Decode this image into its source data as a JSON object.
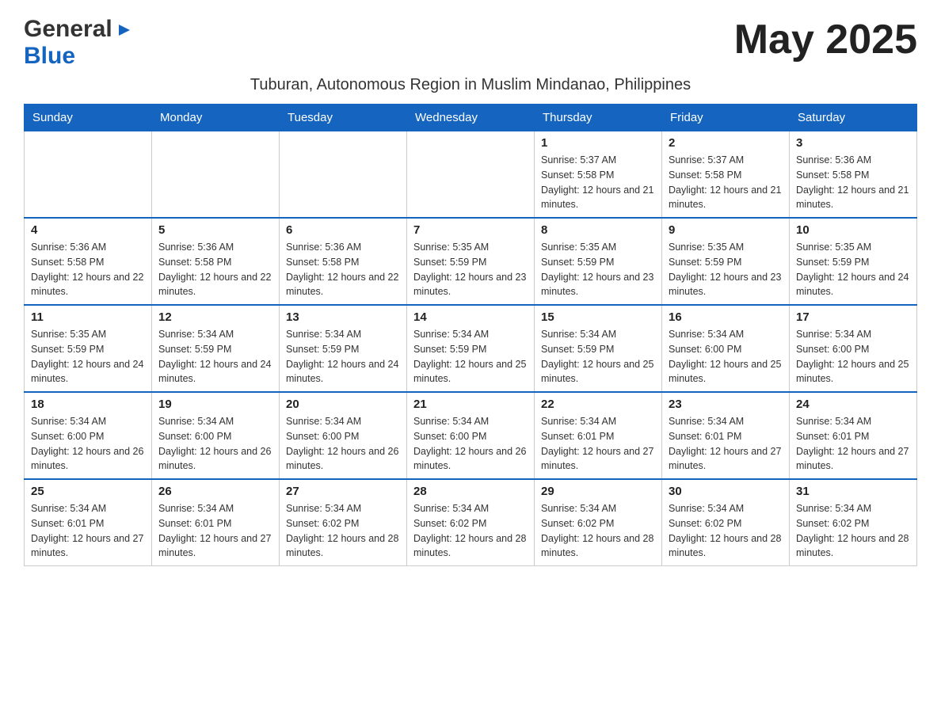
{
  "logo": {
    "general": "General",
    "blue": "Blue",
    "arrow": "▶"
  },
  "title": "May 2025",
  "subtitle": "Tuburan, Autonomous Region in Muslim Mindanao, Philippines",
  "weekdays": [
    "Sunday",
    "Monday",
    "Tuesday",
    "Wednesday",
    "Thursday",
    "Friday",
    "Saturday"
  ],
  "weeks": [
    [
      {
        "day": "",
        "sunrise": "",
        "sunset": "",
        "daylight": ""
      },
      {
        "day": "",
        "sunrise": "",
        "sunset": "",
        "daylight": ""
      },
      {
        "day": "",
        "sunrise": "",
        "sunset": "",
        "daylight": ""
      },
      {
        "day": "",
        "sunrise": "",
        "sunset": "",
        "daylight": ""
      },
      {
        "day": "1",
        "sunrise": "Sunrise: 5:37 AM",
        "sunset": "Sunset: 5:58 PM",
        "daylight": "Daylight: 12 hours and 21 minutes."
      },
      {
        "day": "2",
        "sunrise": "Sunrise: 5:37 AM",
        "sunset": "Sunset: 5:58 PM",
        "daylight": "Daylight: 12 hours and 21 minutes."
      },
      {
        "day": "3",
        "sunrise": "Sunrise: 5:36 AM",
        "sunset": "Sunset: 5:58 PM",
        "daylight": "Daylight: 12 hours and 21 minutes."
      }
    ],
    [
      {
        "day": "4",
        "sunrise": "Sunrise: 5:36 AM",
        "sunset": "Sunset: 5:58 PM",
        "daylight": "Daylight: 12 hours and 22 minutes."
      },
      {
        "day": "5",
        "sunrise": "Sunrise: 5:36 AM",
        "sunset": "Sunset: 5:58 PM",
        "daylight": "Daylight: 12 hours and 22 minutes."
      },
      {
        "day": "6",
        "sunrise": "Sunrise: 5:36 AM",
        "sunset": "Sunset: 5:58 PM",
        "daylight": "Daylight: 12 hours and 22 minutes."
      },
      {
        "day": "7",
        "sunrise": "Sunrise: 5:35 AM",
        "sunset": "Sunset: 5:59 PM",
        "daylight": "Daylight: 12 hours and 23 minutes."
      },
      {
        "day": "8",
        "sunrise": "Sunrise: 5:35 AM",
        "sunset": "Sunset: 5:59 PM",
        "daylight": "Daylight: 12 hours and 23 minutes."
      },
      {
        "day": "9",
        "sunrise": "Sunrise: 5:35 AM",
        "sunset": "Sunset: 5:59 PM",
        "daylight": "Daylight: 12 hours and 23 minutes."
      },
      {
        "day": "10",
        "sunrise": "Sunrise: 5:35 AM",
        "sunset": "Sunset: 5:59 PM",
        "daylight": "Daylight: 12 hours and 24 minutes."
      }
    ],
    [
      {
        "day": "11",
        "sunrise": "Sunrise: 5:35 AM",
        "sunset": "Sunset: 5:59 PM",
        "daylight": "Daylight: 12 hours and 24 minutes."
      },
      {
        "day": "12",
        "sunrise": "Sunrise: 5:34 AM",
        "sunset": "Sunset: 5:59 PM",
        "daylight": "Daylight: 12 hours and 24 minutes."
      },
      {
        "day": "13",
        "sunrise": "Sunrise: 5:34 AM",
        "sunset": "Sunset: 5:59 PM",
        "daylight": "Daylight: 12 hours and 24 minutes."
      },
      {
        "day": "14",
        "sunrise": "Sunrise: 5:34 AM",
        "sunset": "Sunset: 5:59 PM",
        "daylight": "Daylight: 12 hours and 25 minutes."
      },
      {
        "day": "15",
        "sunrise": "Sunrise: 5:34 AM",
        "sunset": "Sunset: 5:59 PM",
        "daylight": "Daylight: 12 hours and 25 minutes."
      },
      {
        "day": "16",
        "sunrise": "Sunrise: 5:34 AM",
        "sunset": "Sunset: 6:00 PM",
        "daylight": "Daylight: 12 hours and 25 minutes."
      },
      {
        "day": "17",
        "sunrise": "Sunrise: 5:34 AM",
        "sunset": "Sunset: 6:00 PM",
        "daylight": "Daylight: 12 hours and 25 minutes."
      }
    ],
    [
      {
        "day": "18",
        "sunrise": "Sunrise: 5:34 AM",
        "sunset": "Sunset: 6:00 PM",
        "daylight": "Daylight: 12 hours and 26 minutes."
      },
      {
        "day": "19",
        "sunrise": "Sunrise: 5:34 AM",
        "sunset": "Sunset: 6:00 PM",
        "daylight": "Daylight: 12 hours and 26 minutes."
      },
      {
        "day": "20",
        "sunrise": "Sunrise: 5:34 AM",
        "sunset": "Sunset: 6:00 PM",
        "daylight": "Daylight: 12 hours and 26 minutes."
      },
      {
        "day": "21",
        "sunrise": "Sunrise: 5:34 AM",
        "sunset": "Sunset: 6:00 PM",
        "daylight": "Daylight: 12 hours and 26 minutes."
      },
      {
        "day": "22",
        "sunrise": "Sunrise: 5:34 AM",
        "sunset": "Sunset: 6:01 PM",
        "daylight": "Daylight: 12 hours and 27 minutes."
      },
      {
        "day": "23",
        "sunrise": "Sunrise: 5:34 AM",
        "sunset": "Sunset: 6:01 PM",
        "daylight": "Daylight: 12 hours and 27 minutes."
      },
      {
        "day": "24",
        "sunrise": "Sunrise: 5:34 AM",
        "sunset": "Sunset: 6:01 PM",
        "daylight": "Daylight: 12 hours and 27 minutes."
      }
    ],
    [
      {
        "day": "25",
        "sunrise": "Sunrise: 5:34 AM",
        "sunset": "Sunset: 6:01 PM",
        "daylight": "Daylight: 12 hours and 27 minutes."
      },
      {
        "day": "26",
        "sunrise": "Sunrise: 5:34 AM",
        "sunset": "Sunset: 6:01 PM",
        "daylight": "Daylight: 12 hours and 27 minutes."
      },
      {
        "day": "27",
        "sunrise": "Sunrise: 5:34 AM",
        "sunset": "Sunset: 6:02 PM",
        "daylight": "Daylight: 12 hours and 28 minutes."
      },
      {
        "day": "28",
        "sunrise": "Sunrise: 5:34 AM",
        "sunset": "Sunset: 6:02 PM",
        "daylight": "Daylight: 12 hours and 28 minutes."
      },
      {
        "day": "29",
        "sunrise": "Sunrise: 5:34 AM",
        "sunset": "Sunset: 6:02 PM",
        "daylight": "Daylight: 12 hours and 28 minutes."
      },
      {
        "day": "30",
        "sunrise": "Sunrise: 5:34 AM",
        "sunset": "Sunset: 6:02 PM",
        "daylight": "Daylight: 12 hours and 28 minutes."
      },
      {
        "day": "31",
        "sunrise": "Sunrise: 5:34 AM",
        "sunset": "Sunset: 6:02 PM",
        "daylight": "Daylight: 12 hours and 28 minutes."
      }
    ]
  ]
}
